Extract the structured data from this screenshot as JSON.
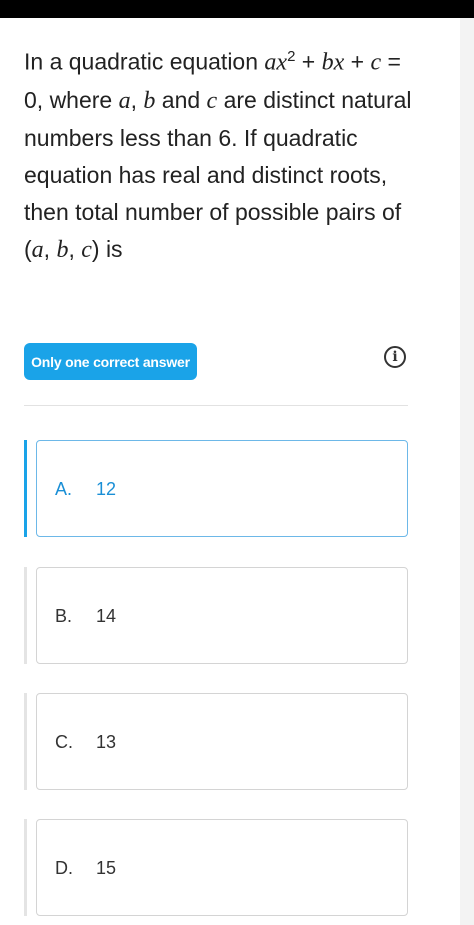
{
  "question": {
    "t1": "In a quadratic equation ",
    "a": "ax",
    "exp": "2",
    "t2": " + ",
    "bx": "bx",
    "t3": " + ",
    "c": "c",
    "t4": " = 0, where ",
    "va": "a",
    "t5": ", ",
    "vb": "b",
    "t6": " and ",
    "vc": "c",
    "t7": " are distinct natural numbers less than 6. If quadratic equation has real and distinct roots, then total number of possible pairs of (",
    "pa": "a",
    "t8": ", ",
    "pb": "b",
    "t9": ", ",
    "pc": "c",
    "t10": ") is"
  },
  "badge": "Only one correct answer",
  "info_icon": "i",
  "options": [
    {
      "letter": "A.",
      "value": "12",
      "selected": true
    },
    {
      "letter": "B.",
      "value": "14",
      "selected": false
    },
    {
      "letter": "C.",
      "value": "13",
      "selected": false
    },
    {
      "letter": "D.",
      "value": "15",
      "selected": false
    }
  ],
  "colors": {
    "accent": "#1aa3e8",
    "selected_text": "#1a8fd6"
  }
}
